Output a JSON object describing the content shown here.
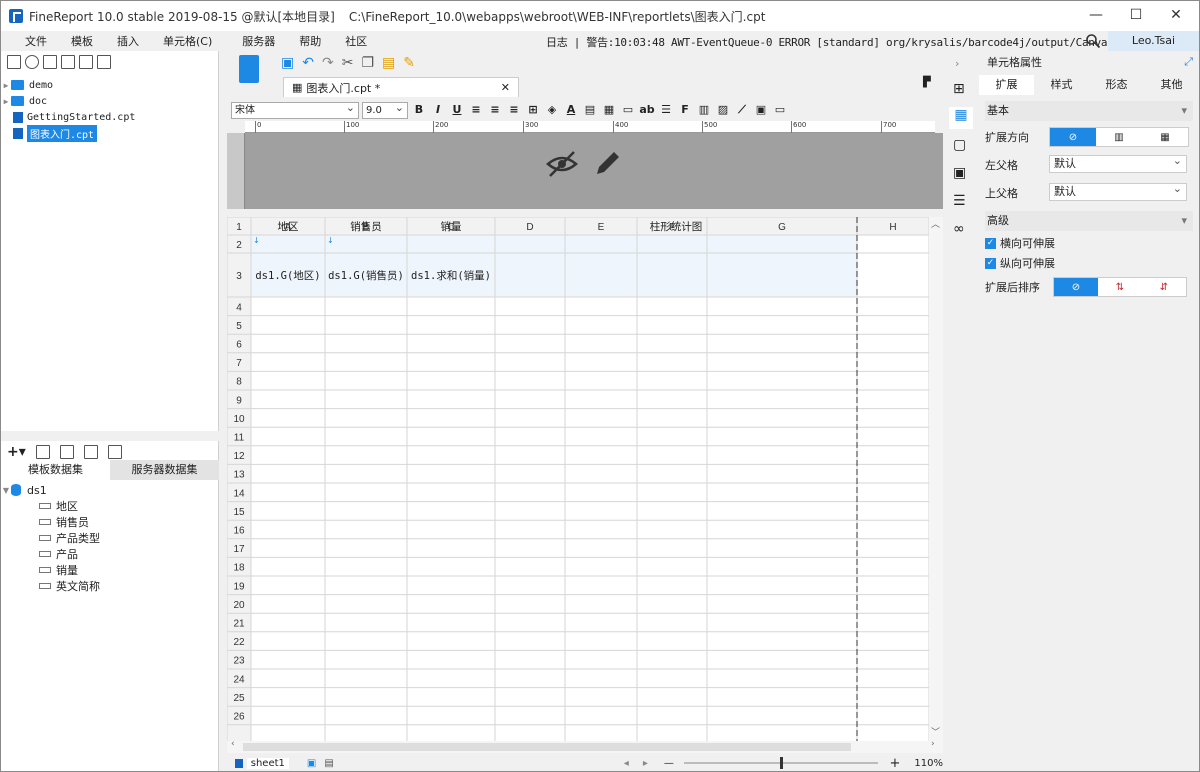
{
  "window": {
    "title": "FineReport 10.0 stable 2019-08-15 @默认[本地目录]",
    "path": "C:\\FineReport_10.0\\webapps\\webroot\\WEB-INF\\reportlets\\图表入门.cpt",
    "min": "—",
    "max": "☐",
    "close": "✕"
  },
  "menu": {
    "items": [
      "文件",
      "模板",
      "插入",
      "单元格(C)",
      "服务器",
      "帮助",
      "社区"
    ],
    "log_text": "日志 | 警告:10:03:48 AWT-EventQueue-0 ERROR [standard] org/krysalis/barcode4j/output/CanvasProvider",
    "user": "Leo.Tsai"
  },
  "file_tree": {
    "items": [
      {
        "name": "demo",
        "type": "folder"
      },
      {
        "name": "doc",
        "type": "folder"
      },
      {
        "name": "GettingStarted.cpt",
        "type": "file"
      },
      {
        "name": "图表入门.cpt",
        "type": "file",
        "selected": true
      }
    ]
  },
  "dataset": {
    "tabs": [
      "模板数据集",
      "服务器数据集"
    ],
    "ds_name": "ds1",
    "fields": [
      "地区",
      "销售员",
      "产品类型",
      "产品",
      "销量",
      "英文简称"
    ]
  },
  "editor": {
    "tab_label": "图表入门.cpt *",
    "font": "宋体",
    "font_size": "9.0",
    "ruler_labels": [
      "0",
      "100",
      "200",
      "300",
      "400",
      "500",
      "600",
      "700"
    ],
    "columns": [
      "A",
      "B",
      "C",
      "D",
      "E",
      "F",
      "G",
      "H"
    ],
    "row_count": 26,
    "cells": {
      "a1": "地区",
      "b1": "销售员",
      "c1": "销量",
      "d1": "柱形统计图",
      "a2": "ds1.G(地区)",
      "b2": "ds1.G(销售员)",
      "c2": "ds1.求和(销量)"
    },
    "sheet_tab": "sheet1",
    "zoom": "110%"
  },
  "properties": {
    "title": "单元格属性",
    "tabs": [
      "扩展",
      "样式",
      "形态",
      "其他"
    ],
    "basic_section": "基本",
    "expand_direction_label": "扩展方向",
    "left_parent_label": "左父格",
    "left_parent_value": "默认",
    "top_parent_label": "上父格",
    "top_parent_value": "默认",
    "advanced_section": "高级",
    "horiz_extend": "横向可伸展",
    "vert_extend": "纵向可伸展",
    "sort_label": "扩展后排序"
  },
  "colors": {
    "accent": "#1e88e5",
    "selected_bg": "#1e88e5",
    "header_gray": "#a0a0a0"
  }
}
